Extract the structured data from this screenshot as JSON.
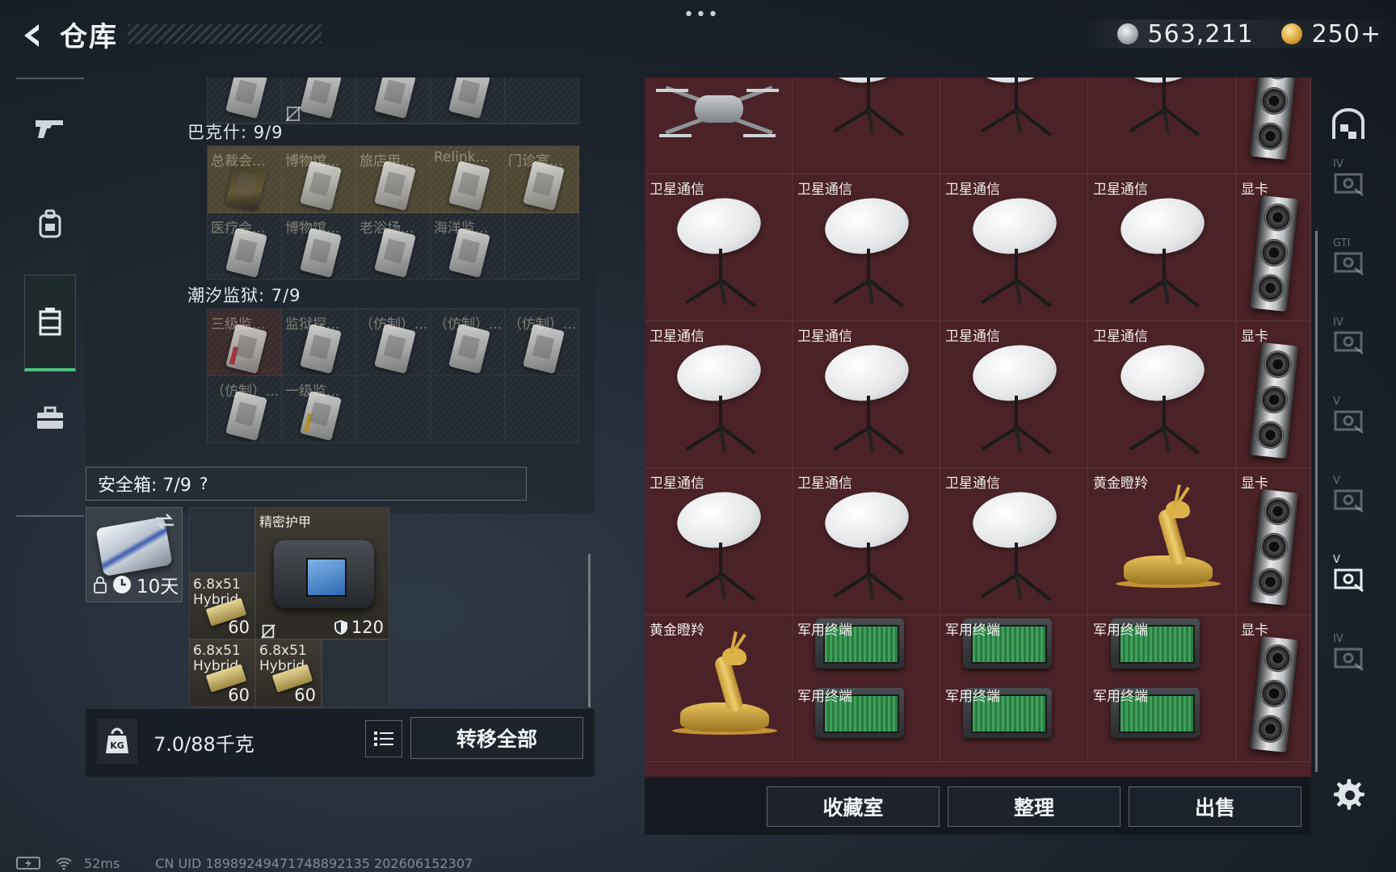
{
  "header": {
    "title": "仓库",
    "more": "•••",
    "currency": [
      {
        "icon": "silver-coin-icon",
        "value": "563,211"
      },
      {
        "icon": "gold-coin-icon",
        "value": "250+"
      }
    ]
  },
  "left_nav": {
    "items": [
      {
        "icon": "gun-icon",
        "active": false
      },
      {
        "icon": "backpack-icon",
        "active": false
      },
      {
        "icon": "container-icon",
        "active": true
      },
      {
        "icon": "briefcase-icon",
        "active": false
      }
    ],
    "accent_color": "#4fc07f"
  },
  "backpack": {
    "sections": [
      {
        "label": "巴克什: 9/9",
        "rows": [
          [
            {
              "label": "总裁会...",
              "tone": "yellow",
              "dark": true
            },
            {
              "label": "博物馆...",
              "tone": "yellow"
            },
            {
              "label": "旅店用...",
              "tone": "yellow"
            },
            {
              "label": "Relink...",
              "tone": "yellow"
            },
            {
              "label": "门诊室...",
              "tone": "yellow"
            }
          ],
          [
            {
              "label": "医疗会...",
              "tone": "normal"
            },
            {
              "label": "博物馆...",
              "tone": "normal"
            },
            {
              "label": "老浴场...",
              "tone": "normal"
            },
            {
              "label": "海洋监...",
              "tone": "normal"
            },
            {
              "label": "",
              "tone": "empty"
            }
          ]
        ]
      },
      {
        "label": "潮汐监狱: 7/9",
        "rows": [
          [
            {
              "label": "三级监...",
              "tone": "red",
              "stripe": "red"
            },
            {
              "label": "监狱探...",
              "tone": "normal"
            },
            {
              "label": "（仿制）...",
              "tone": "normal"
            },
            {
              "label": "（仿制）...",
              "tone": "normal"
            },
            {
              "label": "（仿制）...",
              "tone": "normal"
            }
          ],
          [
            {
              "label": "（仿制）...",
              "tone": "normal"
            },
            {
              "label": "一级监...",
              "tone": "normal",
              "stripe": "gold"
            },
            {
              "label": "",
              "tone": "empty"
            },
            {
              "label": "",
              "tone": "empty"
            },
            {
              "label": "",
              "tone": "empty"
            }
          ]
        ]
      }
    ],
    "safebox": {
      "label": "安全箱: 7/9",
      "help": "?"
    },
    "safe_case": {
      "timer": "10天"
    },
    "safe_slots": {
      "armor": {
        "label": "精密护甲",
        "durability": "120"
      },
      "ammo": [
        {
          "label": "6.8x51\nHybrid",
          "count": "60"
        },
        {
          "label": "6.8x51\nHybrid",
          "count": "60"
        },
        {
          "label": "6.8x51\nHybrid",
          "count": "60"
        }
      ]
    },
    "weight": "7.0/88千克",
    "transfer_all": "转移全部"
  },
  "storage": {
    "grid_color": "#4a2227",
    "rows": [
      [
        "drone",
        "dish",
        "dish",
        "dish",
        "gpu"
      ],
      [
        "dish",
        "dish",
        "dish",
        "dish",
        "gpu"
      ],
      [
        "dish",
        "dish",
        "dish",
        "dish",
        "gpu"
      ],
      [
        "dish",
        "dish",
        "dish",
        "deer",
        "gpu"
      ],
      [
        "deer",
        "terminal",
        "terminal",
        "terminal",
        "gpu"
      ]
    ],
    "labels": {
      "dish": "卫星通信",
      "gpu": "显卡",
      "deer": "黄金瞪羚",
      "terminal": "军用终端"
    },
    "buttons": {
      "collection": "收藏室",
      "sort": "整理",
      "sell": "出售"
    }
  },
  "right_nav": {
    "items": [
      {
        "icon": "garage-icon",
        "tag": ""
      },
      {
        "icon": "storage-tab-icon",
        "tag": "IV"
      },
      {
        "icon": "storage-tab-icon",
        "tag": "GTI"
      },
      {
        "icon": "storage-tab-icon",
        "tag": "IV"
      },
      {
        "icon": "storage-tab-icon",
        "tag": "V"
      },
      {
        "icon": "storage-tab-icon",
        "tag": "V"
      },
      {
        "icon": "storage-tab-icon-active",
        "tag": "V"
      },
      {
        "icon": "storage-tab-icon",
        "tag": "IV"
      }
    ]
  },
  "status": {
    "ping": "52ms",
    "uid": "CN UID 18989249471748892135 202606152307"
  }
}
